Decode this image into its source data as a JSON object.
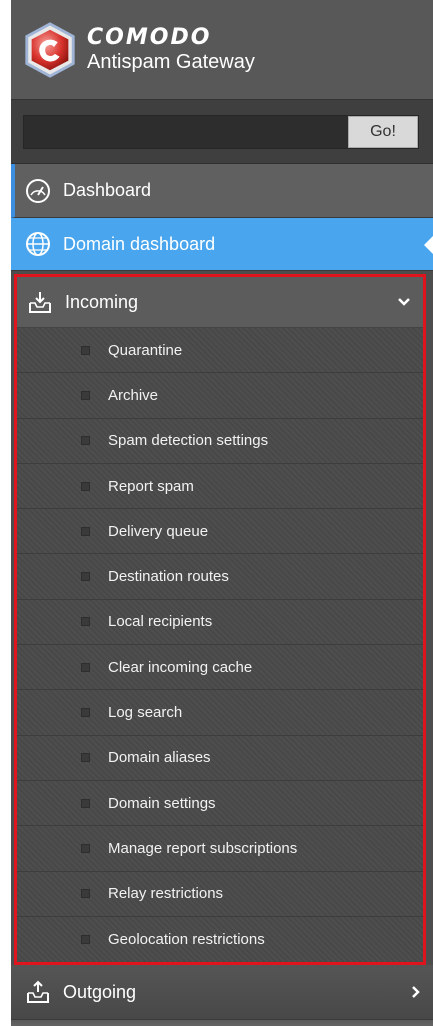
{
  "brand": {
    "name": "COMODO",
    "subtitle": "Antispam Gateway"
  },
  "search": {
    "value": "",
    "go_label": "Go!"
  },
  "nav": {
    "dashboard": {
      "label": "Dashboard",
      "icon": "gauge-icon"
    },
    "domain_dashboard": {
      "label": "Domain dashboard",
      "icon": "globe-icon",
      "selected": true
    },
    "incoming": {
      "label": "Incoming",
      "icon": "inbox-download-icon",
      "expanded": true,
      "items": [
        "Quarantine",
        "Archive",
        "Spam detection settings",
        "Report spam",
        "Delivery queue",
        "Destination routes",
        "Local recipients",
        "Clear incoming cache",
        "Log search",
        "Domain aliases",
        "Domain settings",
        "Manage report subscriptions",
        "Relay restrictions",
        "Geolocation restrictions"
      ]
    },
    "outgoing": {
      "label": "Outgoing",
      "icon": "outbox-upload-icon"
    }
  },
  "colors": {
    "sidebar_bg": "#4d4d4d",
    "selected_bg": "#49a6ee",
    "highlight_border": "#e0141c",
    "dashboard_accent": "#3c8fe0"
  }
}
